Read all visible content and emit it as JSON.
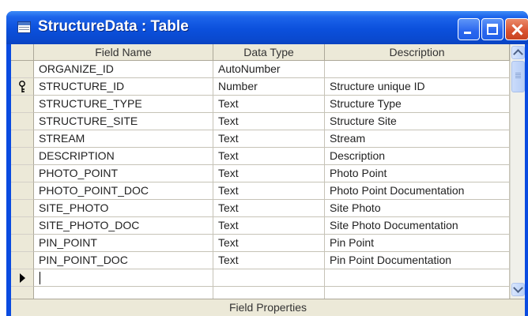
{
  "window": {
    "title": "StructureData : Table",
    "icon": "table-icon",
    "controls": [
      "minimize-icon",
      "maximize-icon",
      "close-icon"
    ]
  },
  "grid": {
    "headers": {
      "field_name": "Field Name",
      "data_type": "Data Type",
      "description": "Description"
    },
    "rows": [
      {
        "field_name": "ORGANIZE_ID",
        "data_type": "AutoNumber",
        "description": "",
        "selector": ""
      },
      {
        "field_name": "STRUCTURE_ID",
        "data_type": "Number",
        "description": "Structure unique ID",
        "selector": "primary-key-icon"
      },
      {
        "field_name": "STRUCTURE_TYPE",
        "data_type": "Text",
        "description": "Structure Type",
        "selector": ""
      },
      {
        "field_name": "STRUCTURE_SITE",
        "data_type": "Text",
        "description": "Structure Site",
        "selector": ""
      },
      {
        "field_name": "STREAM",
        "data_type": "Text",
        "description": "Stream",
        "selector": ""
      },
      {
        "field_name": "DESCRIPTION",
        "data_type": "Text",
        "description": "Description",
        "selector": ""
      },
      {
        "field_name": "PHOTO_POINT",
        "data_type": "Text",
        "description": "Photo Point",
        "selector": ""
      },
      {
        "field_name": "PHOTO_POINT_DOC",
        "data_type": "Text",
        "description": "Photo Point Documentation",
        "selector": ""
      },
      {
        "field_name": "SITE_PHOTO",
        "data_type": "Text",
        "description": "Site Photo",
        "selector": ""
      },
      {
        "field_name": "SITE_PHOTO_DOC",
        "data_type": "Text",
        "description": "Site Photo Documentation",
        "selector": ""
      },
      {
        "field_name": "PIN_POINT",
        "data_type": "Text",
        "description": "Pin Point",
        "selector": ""
      },
      {
        "field_name": "PIN_POINT_DOC",
        "data_type": "Text",
        "description": "Pin Point Documentation",
        "selector": ""
      },
      {
        "field_name": "",
        "data_type": "",
        "description": "",
        "selector": "current-row-arrow-icon"
      },
      {
        "field_name": "",
        "data_type": "",
        "description": "",
        "selector": ""
      }
    ]
  },
  "field_properties": {
    "label": "Field Properties"
  },
  "colors": {
    "title_bar": "#0a4be0",
    "close_button": "#d8512e",
    "header_background": "#ece9d8"
  }
}
